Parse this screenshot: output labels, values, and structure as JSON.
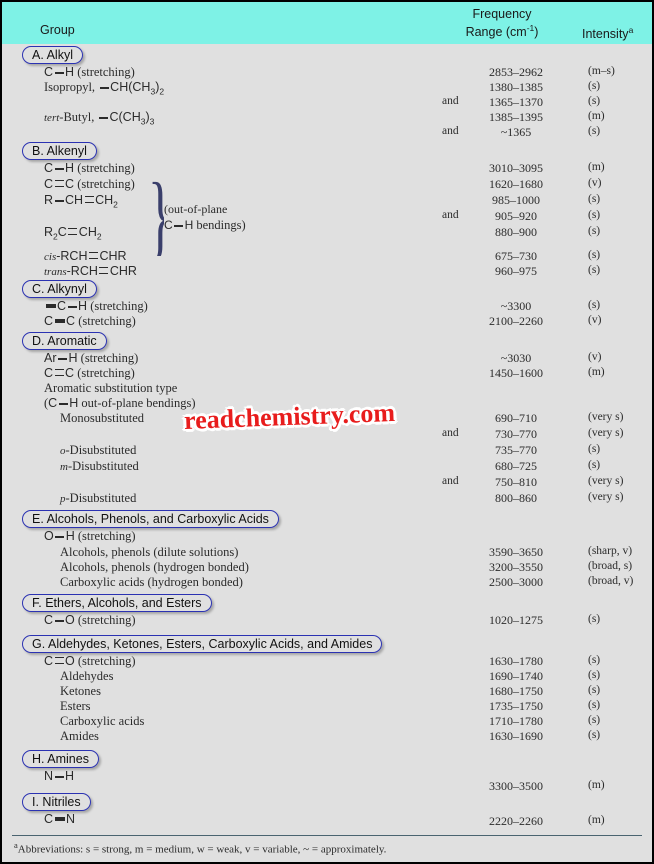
{
  "header": {
    "group_label": "Group",
    "frequency_line1": "Frequency",
    "frequency_line2": "Range (cm",
    "frequency_exp": "-1",
    "frequency_line2_end": ")",
    "intensity_label": "Intensity",
    "intensity_sup": "a",
    "band_color": "#7ef2e6",
    "background_color": "#e0e0e0",
    "pill_border_color": "#2b32b2"
  },
  "watermark": {
    "text": "readchemistry.com",
    "color": "#e81c1c"
  },
  "and_label": "and",
  "sections": [
    {
      "id": "A",
      "title": "A. Alkyl",
      "rows": [
        {
          "label_html": "C—H (stretching)",
          "and": "",
          "freq": "2853–2962",
          "intensity": "(m–s)"
        },
        {
          "label_html": "Isopropyl, —CH(CH3)2",
          "and": "",
          "freq": "1380–1385",
          "intensity": "(s)"
        },
        {
          "label_html": "",
          "and": "and",
          "freq": "1365–1370",
          "intensity": "(s)"
        },
        {
          "label_html": "tert-Butyl, —C(CH3)3",
          "and": "",
          "freq": "1385–1395",
          "intensity": "(m)"
        },
        {
          "label_html": "",
          "and": "and",
          "freq": "~1365",
          "intensity": "(s)"
        }
      ]
    },
    {
      "id": "B",
      "title": "B. Alkenyl",
      "brace_note_line1": "(out-of-plane",
      "brace_note_line2": "C—H bendings)",
      "rows": [
        {
          "label_html": "C—H (stretching)",
          "and": "",
          "freq": "3010–3095",
          "intensity": "(m)"
        },
        {
          "label_html": "C=C (stretching)",
          "and": "",
          "freq": "1620–1680",
          "intensity": "(v)"
        },
        {
          "label_html": "R—CH=CH2",
          "and": "",
          "freq": "985–1000",
          "intensity": "(s)"
        },
        {
          "label_html": "",
          "and": "and",
          "freq": "905–920",
          "intensity": "(s)"
        },
        {
          "label_html": "R2C=CH2",
          "and": "",
          "freq": "880–900",
          "intensity": "(s)"
        },
        {
          "label_html": "cis-RCH=CHR",
          "and": "",
          "freq": "675–730",
          "intensity": "(s)"
        },
        {
          "label_html": "trans-RCH=CHR",
          "and": "",
          "freq": "960–975",
          "intensity": "(s)"
        }
      ]
    },
    {
      "id": "C",
      "title": "C. Alkynyl",
      "rows": [
        {
          "label_html": "≡C—H (stretching)",
          "and": "",
          "freq": "~3300",
          "intensity": "(s)"
        },
        {
          "label_html": "C≡C (stretching)",
          "and": "",
          "freq": "2100–2260",
          "intensity": "(v)"
        }
      ]
    },
    {
      "id": "D",
      "title": "D. Aromatic",
      "rows": [
        {
          "label_html": "Ar—H (stretching)",
          "and": "",
          "freq": "~3030",
          "intensity": "(v)"
        },
        {
          "label_html": "C=C (stretching)",
          "and": "",
          "freq": "1450–1600",
          "intensity": "(m)"
        },
        {
          "label_html": "Aromatic substitution type",
          "and": "",
          "freq": "",
          "intensity": ""
        },
        {
          "label_html": "(C—H out-of-plane bendings)",
          "and": "",
          "freq": "",
          "intensity": ""
        },
        {
          "label_html": "Monosubstituted",
          "and": "",
          "freq": "690–710",
          "intensity": "(very s)"
        },
        {
          "label_html": "",
          "and": "and",
          "freq": "730–770",
          "intensity": "(very s)"
        },
        {
          "label_html": "o-Disubstituted",
          "and": "",
          "freq": "735–770",
          "intensity": "(s)"
        },
        {
          "label_html": "m-Disubstituted",
          "and": "",
          "freq": "680–725",
          "intensity": "(s)"
        },
        {
          "label_html": "",
          "and": "and",
          "freq": "750–810",
          "intensity": "(very s)"
        },
        {
          "label_html": "p-Disubstituted",
          "and": "",
          "freq": "800–860",
          "intensity": "(very s)"
        }
      ]
    },
    {
      "id": "E",
      "title": "E. Alcohols, Phenols, and Carboxylic Acids",
      "rows": [
        {
          "label_html": "O—H (stretching)",
          "and": "",
          "freq": "",
          "intensity": ""
        },
        {
          "label_html": "Alcohols, phenols (dilute solutions)",
          "and": "",
          "freq": "3590–3650",
          "intensity": "(sharp, v)"
        },
        {
          "label_html": "Alcohols, phenols (hydrogen bonded)",
          "and": "",
          "freq": "3200–3550",
          "intensity": "(broad, s)"
        },
        {
          "label_html": "Carboxylic acids (hydrogen bonded)",
          "and": "",
          "freq": "2500–3000",
          "intensity": "(broad, v)"
        }
      ]
    },
    {
      "id": "F",
      "title": "F. Ethers, Alcohols, and Esters",
      "rows": [
        {
          "label_html": "C—O (stretching)",
          "and": "",
          "freq": "1020–1275",
          "intensity": "(s)"
        }
      ]
    },
    {
      "id": "G",
      "title": "G. Aldehydes, Ketones, Esters, Carboxylic Acids, and Amides",
      "rows": [
        {
          "label_html": "C=O (stretching)",
          "and": "",
          "freq": "1630–1780",
          "intensity": "(s)"
        },
        {
          "label_html": "Aldehydes",
          "and": "",
          "freq": "1690–1740",
          "intensity": "(s)"
        },
        {
          "label_html": "Ketones",
          "and": "",
          "freq": "1680–1750",
          "intensity": "(s)"
        },
        {
          "label_html": "Esters",
          "and": "",
          "freq": "1735–1750",
          "intensity": "(s)"
        },
        {
          "label_html": "Carboxylic acids",
          "and": "",
          "freq": "1710–1780",
          "intensity": "(s)"
        },
        {
          "label_html": "Amides",
          "and": "",
          "freq": "1630–1690",
          "intensity": "(s)"
        }
      ]
    },
    {
      "id": "H",
      "title": "H. Amines",
      "rows": [
        {
          "label_html": "N—H",
          "and": "",
          "freq": "3300–3500",
          "intensity": "(m)"
        }
      ]
    },
    {
      "id": "I",
      "title": "I. Nitriles",
      "rows": [
        {
          "label_html": "C≡N",
          "and": "",
          "freq": "2220–2260",
          "intensity": "(m)"
        }
      ]
    }
  ],
  "footnote": "aAbbreviations: s = strong, m = medium, w = weak, v = variable, ~ = approximately."
}
